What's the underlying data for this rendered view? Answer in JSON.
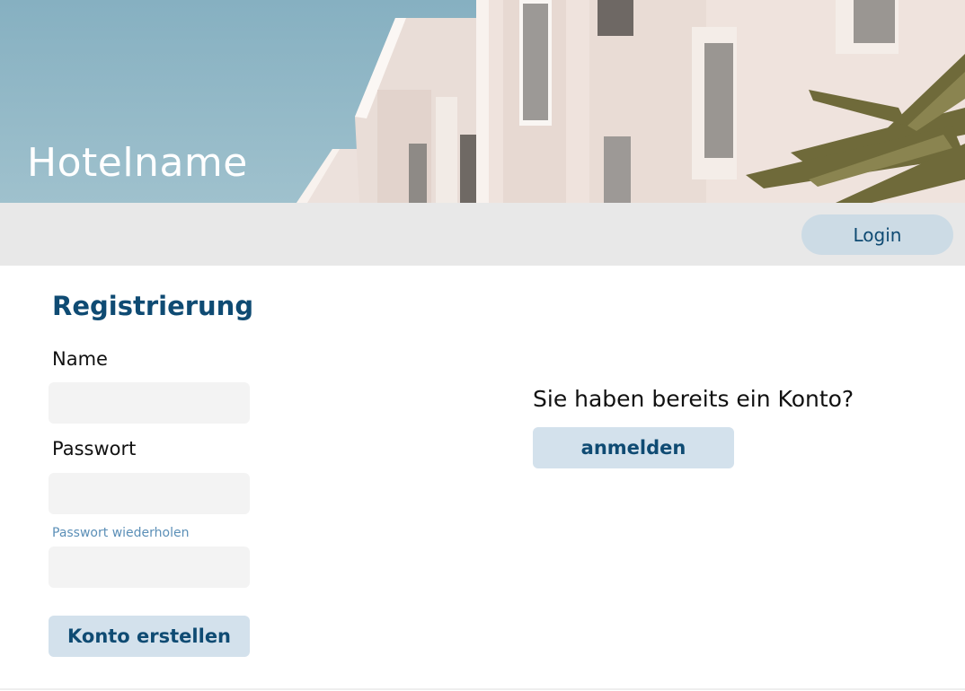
{
  "header": {
    "hotel_name": "Hotelname"
  },
  "nav": {
    "login_label": "Login"
  },
  "registration": {
    "title": "Registrierung",
    "name_label": "Name",
    "name_value": "",
    "password_label": "Passwort",
    "password_value": "",
    "repeat_password_label": "Passwort wiederholen",
    "repeat_password_value": "",
    "submit_label": "Konto erstellen"
  },
  "existing_account": {
    "question": "Sie haben bereits ein Konto?",
    "button_label": "anmelden"
  },
  "colors": {
    "accent": "#0f4b73",
    "button_bg": "#d3e1ec",
    "input_bg": "#f3f3f3",
    "nav_bg": "#e8e8e8"
  }
}
